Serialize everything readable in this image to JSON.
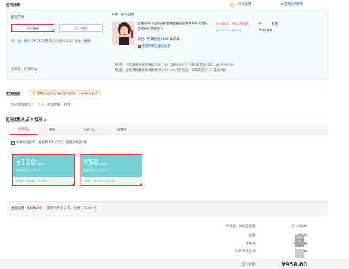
{
  "header": {
    "title": "送货清单",
    "price_info": "价格说明",
    "back_cart": "返回修改购物车"
  },
  "shipping": {
    "method_label": "配送方式",
    "btn_jd": "京东快递",
    "btn_pickup": "上门自提",
    "standard_label": "标　准：预计 3月25日[周日] 09:00-21:00 送达",
    "edit": "修改",
    "weight_label": "总重量：0.105kg"
  },
  "seller": {
    "label": "商家：京东自营"
  },
  "product": {
    "name": "兰蔻Ipm口红唇光雾面雾面哑光唇釉#196 化妆礼盒生日礼物送女友",
    "price": "¥ 319.53 PLUS专享价",
    "orig_price": "¥ 380.00 原价价",
    "qty": "x1",
    "stock": "有货",
    "weight": "0.025kg",
    "color": "颜色：经典哑光#196 柔砂橘",
    "service": "支持7天无理由退货",
    "gift1": "【赠品】 兰蔻净澈焕肤双重精华水 7ml【满99加价】*有效期至20/11/1 x1  查看价格",
    "gift2": "【赠品】 兰蔻菁纯臻颜焕亮眼霜 PO-01 5ml【非卖品，请勿购买】 x1  查看价格"
  },
  "invoice": {
    "title": "发票信息",
    "hint": "使用礼品卡支付部分的金额，不支持开发票",
    "value": "电子增值发票 ⓘ　个人　商品明细",
    "edit": "修改"
  },
  "coupons": {
    "title": "使用优惠/礼品卡/抵用 ∧",
    "tabs": [
      "优惠券",
      "京豆",
      "礼品卡",
      "领券码"
    ],
    "summary_checkbox": "优惠组合推荐，共抵用170.00元；使用优惠券2张",
    "items": [
      {
        "amount": "¥120",
        "cond": "满899",
        "date": "有效期至2023-05-26",
        "tags": "[东券]　[限品类]　[可叠加]"
      },
      {
        "amount": "¥50",
        "cond": "满499",
        "date": "有效期至2023-05-26",
        "tags": "[东券]　[限品类]　[可叠加]"
      }
    ],
    "total_label": "金额抵用",
    "total_value": "¥170.00",
    "total_note": "使用优惠券 2 张，优惠 170.00 元"
  },
  "summary": {
    "rows": [
      {
        "label": "1件商品，总商品金额：",
        "value": "¥1140.00"
      },
      {
        "label": "运费：",
        "value": "¥0.00"
      },
      {
        "label": "优惠券：",
        "value": "-¥170.00"
      },
      {
        "label": "PLUS专享立减：",
        "value": "-¥11.90"
      }
    ],
    "payable_label": "应付总额：",
    "payable_value": "¥958.60"
  },
  "side": {
    "feedback": "我要反馈",
    "top": "∧"
  }
}
